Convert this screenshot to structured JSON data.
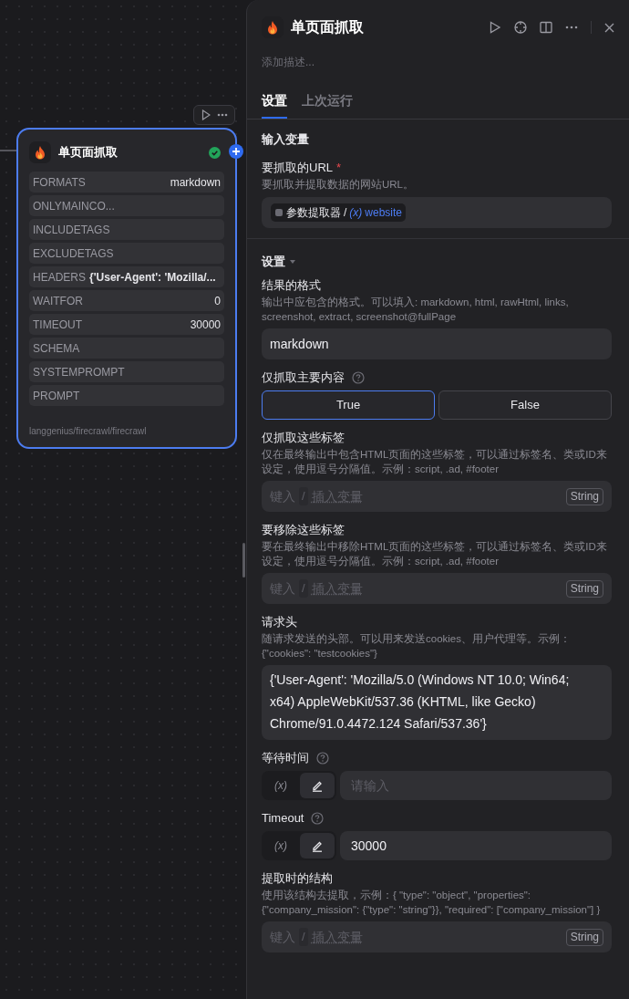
{
  "node": {
    "title": "单页面抓取",
    "status_ok": true,
    "params": [
      {
        "name": "FORMATS",
        "value": "markdown",
        "inline": false
      },
      {
        "name": "ONLYMAINCO..."
      },
      {
        "name": "INCLUDETAGS"
      },
      {
        "name": "EXCLUDETAGS"
      },
      {
        "name": "HEADERS",
        "value": "{'User-Agent': 'Mozilla/...",
        "inline": true
      },
      {
        "name": "WAITFOR",
        "value": "0",
        "inline": false
      },
      {
        "name": "TIMEOUT",
        "value": "30000",
        "inline": false
      },
      {
        "name": "SCHEMA"
      },
      {
        "name": "SYSTEMPROMPT"
      },
      {
        "name": "PROMPT"
      }
    ],
    "footer": "langgenius/firecrawl/firecrawl"
  },
  "panel": {
    "title": "单页面抓取",
    "description_placeholder": "添加描述...",
    "tabs": [
      {
        "label": "设置",
        "selected": true
      },
      {
        "label": "上次运行",
        "selected": false
      }
    ],
    "input_heading": "输入变量",
    "url_field": {
      "label": "要抓取的URL",
      "required_mark": "*",
      "hint": "要抓取并提取数据的网站URL。",
      "node": "参数提取器",
      "separator": "/",
      "var_icon": "(x)",
      "variable": "website"
    },
    "settings": {
      "title": "设置",
      "expanded": true,
      "fields": [
        {
          "kind": "text",
          "label": "结果的格式",
          "hint": "输出中应包含的格式。可以填入: markdown, html, rawHtml, links, screenshot, extract, screenshot@fullPage",
          "value": "markdown"
        },
        {
          "kind": "toggle",
          "label": "仅抓取主要内容",
          "help": true,
          "options": [
            {
              "label": "True",
              "selected": true
            },
            {
              "label": "False",
              "selected": false
            }
          ]
        },
        {
          "kind": "mixed",
          "label": "仅抓取这些标签",
          "hint": "仅在最终输出中包含HTML页面的这些标签，可以通过标签名、类或ID来设定，使用逗号分隔值。示例：script, .ad, #footer",
          "placeholder": [
            "键入",
            "/",
            "插入变量"
          ],
          "type": "String"
        },
        {
          "kind": "mixed",
          "label": "要移除这些标签",
          "hint": "要在最终输出中移除HTML页面的这些标签，可以通过标签名、类或ID来设定，使用逗号分隔值。示例：script, .ad, #footer",
          "placeholder": [
            "键入",
            "/",
            "插入变量"
          ],
          "type": "String"
        },
        {
          "kind": "textarea",
          "label": "请求头",
          "hint": "随请求发送的头部。可以用来发送cookies、用户代理等。示例：{\"cookies\": \"testcookies\"}",
          "value": "{'User-Agent': 'Mozilla/5.0 (Windows NT 10.0; Win64; x64) AppleWebKit/537.36 (KHTML, like Gecko) Chrome/91.0.4472.124 Safari/537.36'}"
        },
        {
          "kind": "number",
          "label": "等待时间",
          "help": true,
          "modes": [
            {
              "kind": "variable",
              "label": "(x)",
              "selected": false
            },
            {
              "kind": "edit",
              "selected": true
            }
          ],
          "placeholder": "请输入"
        },
        {
          "kind": "number",
          "label": "Timeout",
          "help": true,
          "modes": [
            {
              "kind": "variable",
              "label": "(x)",
              "selected": false
            },
            {
              "kind": "edit",
              "selected": true
            }
          ],
          "value": "30000"
        },
        {
          "kind": "mixed",
          "label": "提取时的结构",
          "hint": "使用该结构去提取，示例：{ \"type\": \"object\", \"properties\": {\"company_mission\": {\"type\": \"string\"}}, \"required\": [\"company_mission\"] }",
          "placeholder": [
            "键入",
            "/",
            "插入变量"
          ],
          "type": "String"
        }
      ]
    }
  }
}
